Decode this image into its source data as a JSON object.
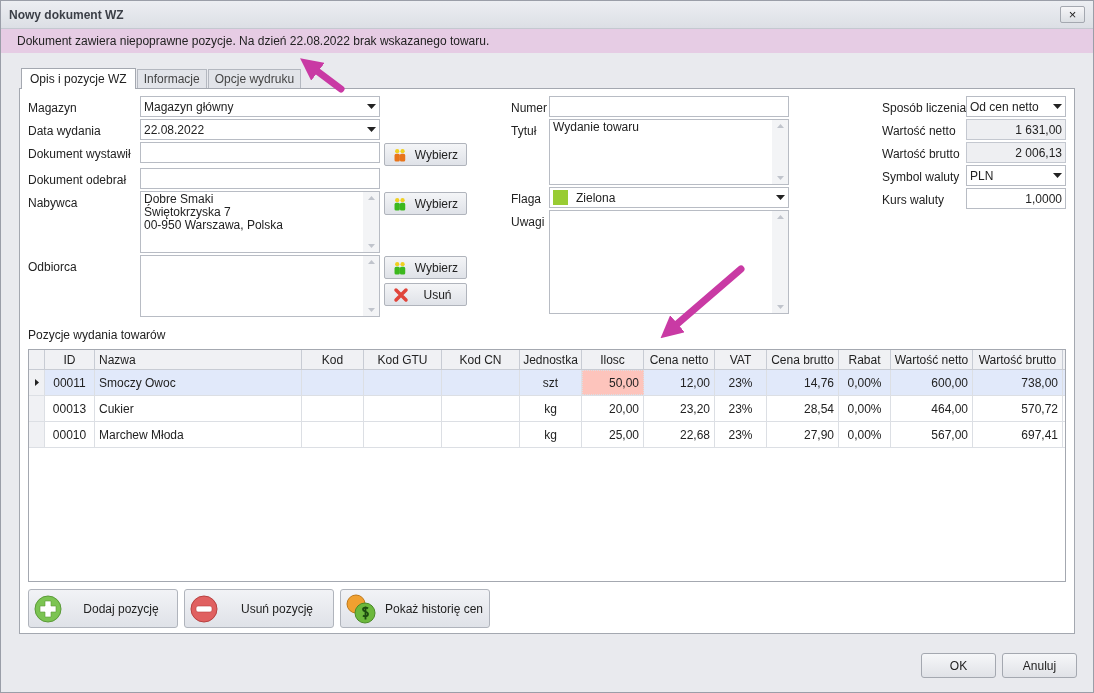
{
  "window": {
    "title": "Nowy dokument WZ",
    "close": "×"
  },
  "message": "Dokument zawiera niepoprawne pozycje. Na dzień 22.08.2022 brak wskazanego towaru.",
  "tabs": [
    {
      "label": "Opis i pozycje WZ",
      "selected": true
    },
    {
      "label": "Informacje",
      "selected": false
    },
    {
      "label": "Opcje wydruku",
      "selected": false
    }
  ],
  "left_fields": [
    {
      "label": "Magazyn",
      "kind": "dropdown",
      "value": "Magazyn główny"
    },
    {
      "label": "Data wydania",
      "kind": "dropdown",
      "value": "22.08.2022"
    },
    {
      "label": "Dokument wystawił",
      "kind": "text",
      "button": {
        "label": "Wybierz",
        "kind": "pick"
      }
    },
    {
      "label": "Dokument odebrał",
      "kind": "text"
    },
    {
      "label": "Nabywca",
      "kind": "memo",
      "lines": [
        "Dobre Smaki",
        "Świętokrzyska 7",
        "00-950 Warszawa, Polska"
      ],
      "button": {
        "label": "Wybierz",
        "kind": "pick"
      }
    },
    {
      "label": "Odbiorca",
      "kind": "memo",
      "button": {
        "label": "Wybierz",
        "kind": "pick"
      },
      "button2": {
        "label": "Usuń",
        "kind": "remove"
      }
    }
  ],
  "middle_fields": [
    {
      "label": "Numer",
      "kind": "text"
    },
    {
      "label": "Tytuł",
      "kind": "memo",
      "lines": [
        "Wydanie towaru"
      ]
    },
    {
      "label": "Flaga",
      "kind": "flag",
      "value": "Zielona",
      "color": "#99cc33"
    },
    {
      "label": "Uwagi",
      "kind": "memo"
    }
  ],
  "right_fields": [
    {
      "label": "Sposób liczenia",
      "kind": "dropdown",
      "value": "Od cen netto"
    },
    {
      "label": "Wartość netto",
      "kind": "readonly",
      "value": "1 631,00"
    },
    {
      "label": "Wartość brutto",
      "kind": "readonly",
      "value": "2 006,13"
    },
    {
      "label": "Symbol waluty",
      "kind": "dropdown",
      "value": "PLN"
    },
    {
      "label": "Kurs waluty",
      "kind": "number",
      "value": "1,0000"
    }
  ],
  "grid": {
    "title": "Pozycje wydania towarów",
    "columns": [
      "ID",
      "Nazwa",
      "Kod",
      "Kod GTU",
      "Kod CN",
      "Jednostka",
      "Ilosc",
      "Cena netto",
      "VAT",
      "Cena brutto",
      "Rabat",
      "Wartość netto",
      "Wartość brutto"
    ],
    "rows": [
      {
        "selected": true,
        "quantity_error": true,
        "cells": [
          "00011",
          "Smoczy Owoc",
          "",
          "",
          "",
          "szt",
          "50,00",
          "12,00",
          "23%",
          "14,76",
          "0,00%",
          "600,00",
          "738,00"
        ]
      },
      {
        "selected": false,
        "quantity_error": false,
        "cells": [
          "00013",
          "Cukier",
          "",
          "",
          "",
          "kg",
          "20,00",
          "23,20",
          "23%",
          "28,54",
          "0,00%",
          "464,00",
          "570,72"
        ]
      },
      {
        "selected": false,
        "quantity_error": false,
        "cells": [
          "00010",
          "Marchew Młoda",
          "",
          "",
          "",
          "kg",
          "25,00",
          "22,68",
          "23%",
          "27,90",
          "0,00%",
          "567,00",
          "697,41"
        ]
      }
    ]
  },
  "actions": [
    {
      "label": "Dodaj pozycję",
      "kind": "add"
    },
    {
      "label": "Usuń pozycję",
      "kind": "remove"
    },
    {
      "label": "Pokaż historię cen",
      "kind": "coins"
    }
  ],
  "footer_buttons": [
    "OK",
    "Anuluj"
  ]
}
